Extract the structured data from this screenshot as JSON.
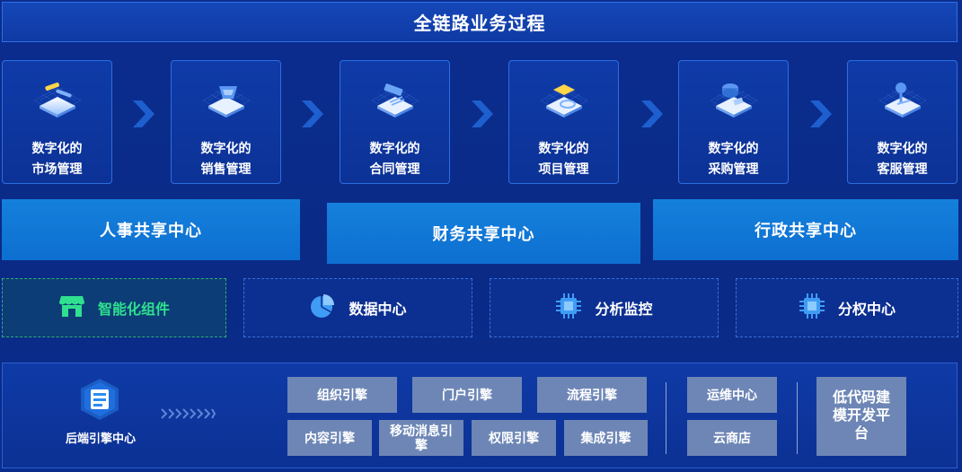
{
  "header": {
    "title": "全链路业务过程"
  },
  "process_cards": [
    {
      "line1": "数字化的",
      "line2": "市场管理",
      "icon": "market-icon"
    },
    {
      "line1": "数字化的",
      "line2": "销售管理",
      "icon": "sales-icon"
    },
    {
      "line1": "数字化的",
      "line2": "合同管理",
      "icon": "contract-icon"
    },
    {
      "line1": "数字化的",
      "line2": "项目管理",
      "icon": "project-icon"
    },
    {
      "line1": "数字化的",
      "line2": "采购管理",
      "icon": "procurement-icon"
    },
    {
      "line1": "数字化的",
      "line2": "客服管理",
      "icon": "customer-service-icon"
    }
  ],
  "shared_centers": [
    {
      "label": "人事共享中心"
    },
    {
      "label": "财务共享中心"
    },
    {
      "label": "行政共享中心"
    }
  ],
  "components": [
    {
      "label": "智能化组件",
      "icon": "store-icon",
      "color": "#2fe08f"
    },
    {
      "label": "数据中心",
      "icon": "pie-chart-icon"
    },
    {
      "label": "分析监控",
      "icon": "chip-icon"
    },
    {
      "label": "分权中心",
      "icon": "chip-icon"
    }
  ],
  "engine": {
    "title": "后端引擎中心",
    "engines": [
      "组织引擎",
      "门户引擎",
      "流程引擎",
      "内容引擎",
      "移动消息引擎",
      "权限引擎",
      "集成引擎"
    ],
    "ops": [
      "运维中心",
      "云商店"
    ],
    "lowcode": "低代码建模开发平台"
  },
  "colors": {
    "background": "#0b2d8f",
    "accent_blue": "#1580dc",
    "green": "#2fe08f",
    "engine_button": "#6d86b6"
  }
}
